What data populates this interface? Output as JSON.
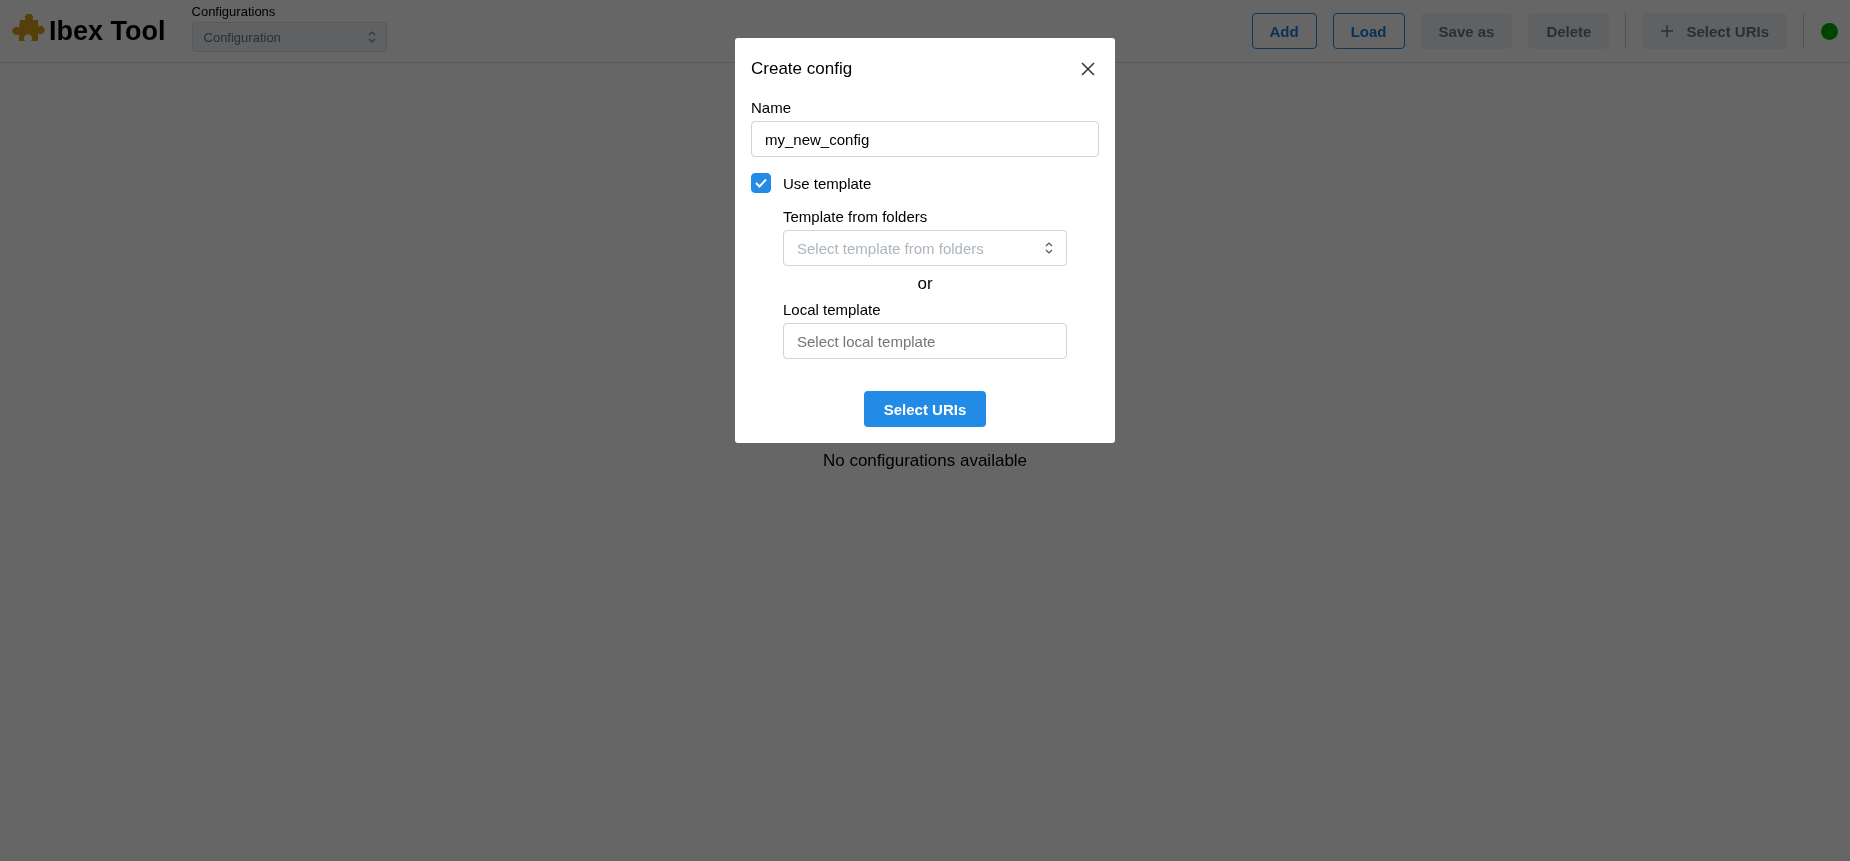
{
  "header": {
    "title": "Ibex Tool",
    "config_select": {
      "label": "Configurations",
      "placeholder": "Configuration",
      "disabled": true
    },
    "buttons": [
      {
        "label": "Add",
        "disabled": false,
        "kind": "text"
      },
      {
        "label": "Load",
        "disabled": false,
        "kind": "text"
      },
      {
        "label": "Save as",
        "disabled": true,
        "kind": "text"
      },
      {
        "label": "Delete",
        "disabled": true,
        "kind": "text"
      },
      {
        "label": "Select URIs",
        "disabled": true,
        "kind": "plus"
      }
    ],
    "status": {
      "online": true
    }
  },
  "main": {
    "empty_message": "No configurations available"
  },
  "dialog": {
    "title": "Create config",
    "name_label": "Name",
    "name_value": "my_new_config",
    "use_template": {
      "label": "Use template",
      "checked": true
    },
    "folder_template": {
      "label": "Template from folders",
      "placeholder": "Select template from folders"
    },
    "separator": "or",
    "local_template": {
      "label": "Local template",
      "placeholder": "Select local template"
    },
    "submit": "Select URIs"
  }
}
